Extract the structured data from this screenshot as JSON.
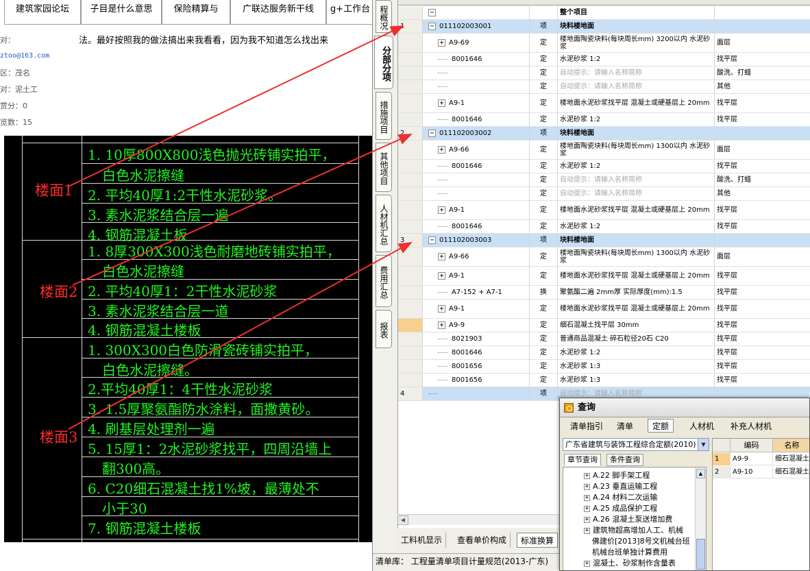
{
  "forum": {
    "tabs": [
      "建筑家园论坛",
      "子目是什么意思",
      "保险精算与",
      "广联达服务新干线",
      "g+工作台"
    ],
    "body_text": "法。最好按照我的做法搞出来我看看，因为我不知道怎么找出来",
    "info": {
      "label1": "对：",
      "email": "ztoo@163.com",
      "name": "区：茂名",
      "major": "对：泥土工",
      "points": "赏分：0",
      "views": "览数：15"
    }
  },
  "cad": {
    "labels": [
      "楼面1",
      "楼面2",
      "楼面3"
    ],
    "rows": [
      "1. 10厚800X800浅色抛光砖铺实拍平，",
      "白色水泥擦缝",
      "2. 平均40厚1:2干性水泥砂浆。",
      "3. 素水泥浆结合层一遍",
      "4. 钢筋混凝土板",
      "1. 8厚300X300浅色耐磨地砖铺实拍平，",
      "白色水泥擦缝",
      "2. 平均40厚1：2干性水泥砂浆",
      "3. 素水泥浆结合层一道",
      "4. 钢筋混凝土楼板",
      "1. 300X300白色防滑瓷砖铺实拍平，",
      "白色水泥擦缝。",
      "2.平均40厚1：4干性水泥砂浆",
      "3. 1.5厚聚氨酯防水涂料，面撒黄砂。",
      "4. 刷基层处理剂一遍",
      "5. 15厚1：2水泥砂浆找平，四周沿墙上",
      "翻300高。",
      "6. C20细石混凝土找1%坡，最薄处不",
      "小于30",
      "7. 钢筋混凝土楼板"
    ]
  },
  "app": {
    "vtabs": [
      "程概况",
      "分部分项",
      "措施项目",
      "其他项目",
      "人材机汇总",
      "费用汇总",
      "报表"
    ],
    "grid": {
      "rows": [
        {
          "no": "",
          "code": "",
          "cat": "",
          "name": "整个项目",
          "feat": "",
          "kind": "root",
          "exp": "−"
        },
        {
          "no": "1",
          "code": "011102003001",
          "cat": "项",
          "name": "块料楼地面",
          "feat": "",
          "kind": "item",
          "exp": "−"
        },
        {
          "no": "",
          "code": "A9-69",
          "cat": "定",
          "name": "楼地面陶瓷块料(每块周长mm) 3200以内 水泥砂浆",
          "feat": "面层",
          "kind": "sub",
          "exp": "+"
        },
        {
          "no": "",
          "code": "8001646",
          "cat": "定",
          "name": "水泥砂浆 1:2",
          "feat": "找平层",
          "kind": "leaf",
          "exp": ""
        },
        {
          "no": "",
          "code": "",
          "cat": "定",
          "name": "自动提示：请输入名称简称",
          "feat": "酸洗、打蜡",
          "kind": "hint",
          "exp": ""
        },
        {
          "no": "",
          "code": "",
          "cat": "定",
          "name": "自动提示：请输入名称简称",
          "feat": "其他",
          "kind": "hint",
          "exp": ""
        },
        {
          "no": "",
          "code": "A9-1",
          "cat": "定",
          "name": "楼地面水泥砂浆找平层 混凝土或硬基层上 20mm",
          "feat": "找平层",
          "kind": "sub",
          "exp": "+"
        },
        {
          "no": "",
          "code": "8001646",
          "cat": "定",
          "name": "水泥砂浆 1:2",
          "feat": "找平层",
          "kind": "leaf",
          "exp": ""
        },
        {
          "no": "2",
          "code": "011102003002",
          "cat": "项",
          "name": "块料楼地面",
          "feat": "",
          "kind": "item",
          "exp": "−"
        },
        {
          "no": "",
          "code": "A9-66",
          "cat": "定",
          "name": "楼地面陶瓷块料(每块周长mm) 1300以内 水泥砂浆",
          "feat": "面层",
          "kind": "sub",
          "exp": "+"
        },
        {
          "no": "",
          "code": "8001646",
          "cat": "定",
          "name": "水泥砂浆 1:2",
          "feat": "找平层",
          "kind": "leaf",
          "exp": ""
        },
        {
          "no": "",
          "code": "",
          "cat": "定",
          "name": "自动提示：请输入名称简称",
          "feat": "酸洗、打蜡",
          "kind": "hint",
          "exp": ""
        },
        {
          "no": "",
          "code": "",
          "cat": "定",
          "name": "自动提示：请输入名称简称",
          "feat": "其他",
          "kind": "hint",
          "exp": ""
        },
        {
          "no": "",
          "code": "A9-1",
          "cat": "定",
          "name": "楼地面水泥砂浆找平层 混凝土或硬基层上 20mm",
          "feat": "找平层",
          "kind": "sub",
          "exp": "+"
        },
        {
          "no": "",
          "code": "8001646",
          "cat": "定",
          "name": "水泥砂浆 1:2",
          "feat": "找平层",
          "kind": "leaf",
          "exp": ""
        },
        {
          "no": "3",
          "code": "011102003003",
          "cat": "项",
          "name": "块料楼地面",
          "feat": "",
          "kind": "item",
          "exp": "−"
        },
        {
          "no": "",
          "code": "A9-66",
          "cat": "定",
          "name": "楼地面陶瓷块料(每块周长mm) 1300以内 水泥砂浆",
          "feat": "面层",
          "kind": "sub",
          "exp": "+"
        },
        {
          "no": "",
          "code": "A9-1",
          "cat": "定",
          "name": "楼地面水泥砂浆找平层 混凝土或硬基层上 20mm",
          "feat": "找平层",
          "kind": "sub",
          "exp": "+"
        },
        {
          "no": "",
          "code": "A7-152 + A7-1",
          "cat": "换",
          "name": "聚氨酯二遍 2mm厚 实际厚度(mm):1.5",
          "feat": "找平层",
          "kind": "leaf",
          "exp": ""
        },
        {
          "no": "",
          "code": "A9-1",
          "cat": "定",
          "name": "楼地面水泥砂浆找平层 混凝土或硬基层上 20mm",
          "feat": "找平层",
          "kind": "sub",
          "exp": "+"
        },
        {
          "no": "",
          "code": "A9-9",
          "cat": "定",
          "name": "细石混凝土找平层 30mm",
          "feat": "找平层",
          "kind": "sub",
          "exp": "+"
        },
        {
          "no": "",
          "code": "8021903",
          "cat": "定",
          "name": "普通商品混凝土 碎石粒径20石 C20",
          "feat": "找平层",
          "kind": "leaf",
          "exp": ""
        },
        {
          "no": "",
          "code": "8001646",
          "cat": "定",
          "name": "水泥砂浆 1:2",
          "feat": "找平层",
          "kind": "leaf",
          "exp": ""
        },
        {
          "no": "",
          "code": "8001656",
          "cat": "定",
          "name": "水泥砂浆 1:3",
          "feat": "找平层",
          "kind": "leaf",
          "exp": ""
        },
        {
          "no": "",
          "code": "8001656",
          "cat": "定",
          "name": "水泥砂浆 1:3",
          "feat": "找平层",
          "kind": "leaf",
          "exp": ""
        },
        {
          "no": "4",
          "code": "",
          "cat": "项",
          "name": "自动提示：请输入名称简称",
          "feat": "",
          "kind": "item-hint",
          "exp": ""
        }
      ]
    },
    "bottom_tabs": [
      "工料机显示",
      "查看单价构成",
      "标准换算"
    ],
    "status": "清单库：  工程量清单项目计量规范(2013-广东)"
  },
  "dialog": {
    "title": "查询",
    "tabs": [
      "清单指引",
      "清单",
      "定额",
      "人材机",
      "补充人材机"
    ],
    "select_value": "广东省建筑与装饰工程综合定额(2010)",
    "subtabs": [
      "章节查询",
      "条件查询"
    ],
    "tree": [
      {
        "label": "A.22 脚手架工程",
        "plus": true
      },
      {
        "label": "A.23 垂直运输工程",
        "plus": true
      },
      {
        "label": "A.24 材料二次运输",
        "plus": true
      },
      {
        "label": "A.25 成品保护工程",
        "plus": true
      },
      {
        "label": "A.26 混凝土泵送增加费",
        "plus": true
      },
      {
        "label": "建筑物超高增加人工、机械",
        "plus": true
      },
      {
        "label": "佛建价[2013]8号文机械台班",
        "plus": false
      },
      {
        "label": "机械台班单独计算费用",
        "plus": false
      },
      {
        "label": "混凝土、砂浆制作含量表",
        "plus": true
      }
    ],
    "result_headers": [
      "编码",
      "名称"
    ],
    "results": [
      {
        "no": "1",
        "code": "A9-9",
        "name": "细石混凝土"
      },
      {
        "no": "2",
        "code": "A9-10",
        "name": "细石混凝土"
      }
    ]
  },
  "colors": {
    "cad_text": "#1ff51f",
    "cad_label": "#ff2a2a",
    "item_row": "#c8dff5",
    "arrow": "#ee3030"
  }
}
